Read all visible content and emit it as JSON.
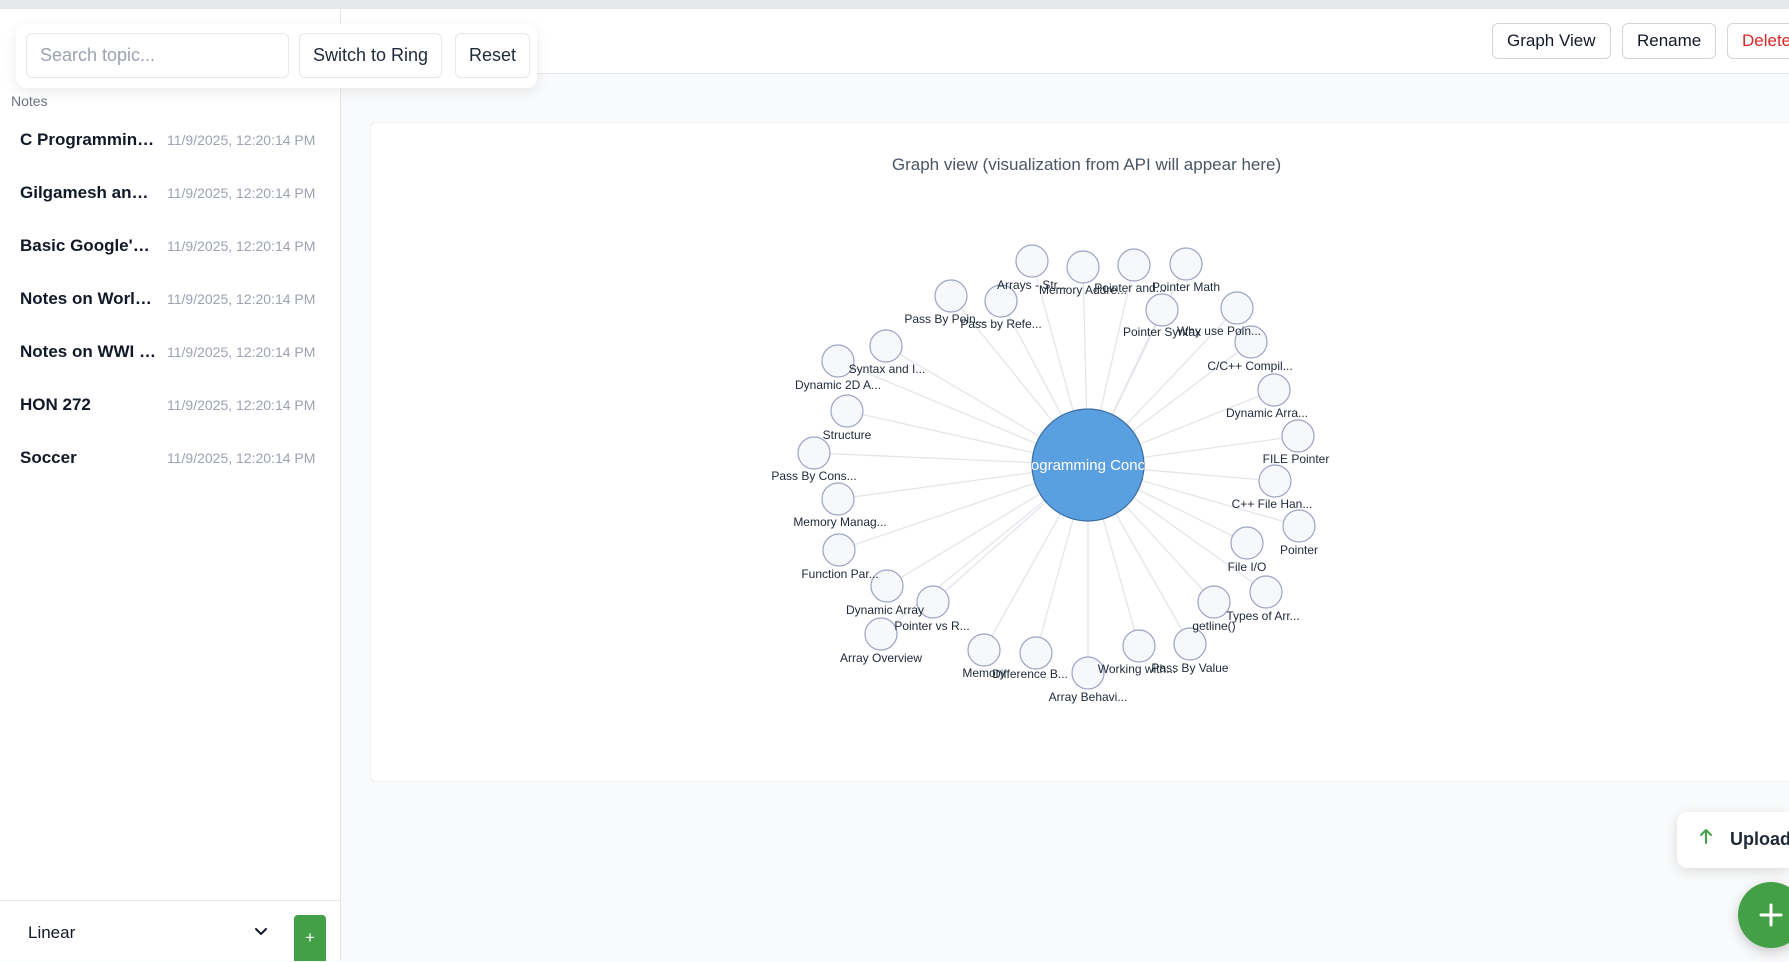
{
  "toolbar": {
    "search_placeholder": "Search topic...",
    "switch_label": "Switch to Ring",
    "reset_label": "Reset"
  },
  "header": {
    "buttons": [
      {
        "label": "Graph View"
      },
      {
        "label": "Rename"
      },
      {
        "label": "Delete"
      }
    ]
  },
  "sidebar": {
    "heading": "Notes",
    "notes": [
      {
        "title": "C Programming...",
        "date": "11/9/2025, 12:20:14 PM"
      },
      {
        "title": "Gilgamesh and ...",
        "date": "11/9/2025, 12:20:14 PM"
      },
      {
        "title": "Basic Google's S...",
        "date": "11/9/2025, 12:20:14 PM"
      },
      {
        "title": "Notes on World...",
        "date": "11/9/2025, 12:20:14 PM"
      },
      {
        "title": "Notes on WWI (...",
        "date": "11/9/2025, 12:20:14 PM"
      },
      {
        "title": "HON 272",
        "date": "11/9/2025, 12:20:14 PM"
      },
      {
        "title": "Soccer",
        "date": "11/9/2025, 12:20:14 PM"
      }
    ],
    "footer": {
      "order_value": "Linear",
      "add_label": "+"
    }
  },
  "graph": {
    "caption": "Graph view (visualization from API will appear here)",
    "center_label": "C Programming Concepts",
    "center_visible_label": "ogramming Conc",
    "nodes": [
      "Arrays - Str...",
      "Memory Addre...",
      "Pointer and...",
      "Pointer Math",
      "Why use Poin...",
      "C/C++ Compil...",
      "Dynamic Arra...",
      "FILE Pointer",
      "C++ File Han...",
      "Pointer",
      "File I/O",
      "Types of Arr...",
      "getline()",
      "Pass By Value",
      "Working with...",
      "Array Behavi...",
      "Difference B...",
      "Memory",
      "Pointer vs R...",
      "Array Overview",
      "Dynamic Array",
      "Function Par...",
      "Memory Manag...",
      "Pass By Cons...",
      "Structure",
      "Dynamic 2D A...",
      "Syntax and I...",
      "Pass By Poin...",
      "Pass by Refe...",
      "Pointer Syntax"
    ]
  },
  "upload": {
    "label": "Upload"
  },
  "fab": {
    "label": "add-note"
  },
  "colors": {
    "center_node": "#5a9fe0",
    "node_stroke": "#9ca3c4",
    "edge": "#e3e5ea",
    "primary_green": "#43a047",
    "danger": "#dc2626"
  }
}
